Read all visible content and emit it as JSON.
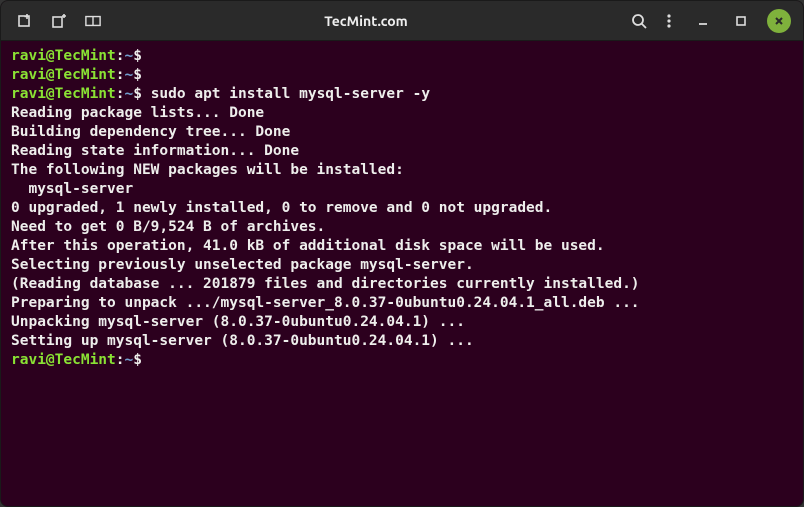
{
  "titlebar": {
    "title": "TecMint.com"
  },
  "prompt": {
    "user_host": "ravi@TecMint",
    "colon": ":",
    "path": "~",
    "symbol": "$"
  },
  "commands": {
    "cmd1": "",
    "cmd2": "",
    "cmd3": "sudo apt install mysql-server -y"
  },
  "output": {
    "l1": "Reading package lists... Done",
    "l2": "Building dependency tree... Done",
    "l3": "Reading state information... Done",
    "l4": "The following NEW packages will be installed:",
    "l5": "  mysql-server",
    "l6": "0 upgraded, 1 newly installed, 0 to remove and 0 not upgraded.",
    "l7": "Need to get 0 B/9,524 B of archives.",
    "l8": "After this operation, 41.0 kB of additional disk space will be used.",
    "l9": "Selecting previously unselected package mysql-server.",
    "l10": "(Reading database ... 201879 files and directories currently installed.)",
    "l11": "Preparing to unpack .../mysql-server_8.0.37-0ubuntu0.24.04.1_all.deb ...",
    "l12": "Unpacking mysql-server (8.0.37-0ubuntu0.24.04.1) ...",
    "l13": "Setting up mysql-server (8.0.37-0ubuntu0.24.04.1) ..."
  }
}
